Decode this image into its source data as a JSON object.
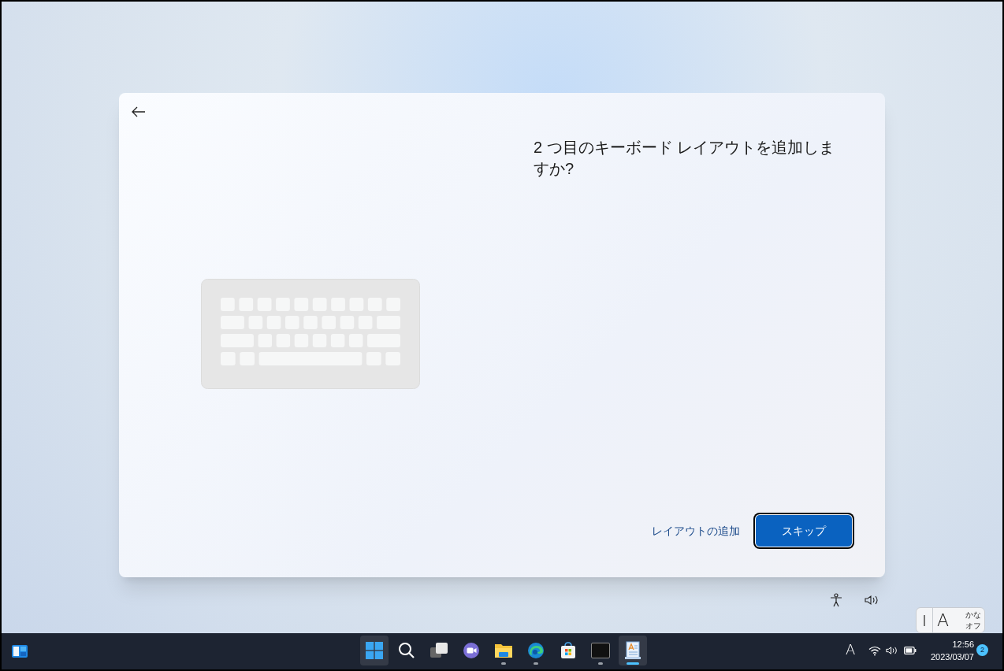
{
  "dialog": {
    "title": "2 つ目のキーボード レイアウトを追加しますか?",
    "secondary_button": "レイアウトの追加",
    "primary_button": "スキップ"
  },
  "ime_toolbar": {
    "mode": "A",
    "kana": "かな",
    "state": "オフ"
  },
  "taskbar": {
    "apps": [
      {
        "kind": "start",
        "running": false,
        "active": true
      },
      {
        "kind": "search",
        "running": false,
        "active": false
      },
      {
        "kind": "taskview",
        "running": false,
        "active": false
      },
      {
        "kind": "chat",
        "running": false,
        "active": false
      },
      {
        "kind": "explorer",
        "running": true,
        "active": false
      },
      {
        "kind": "edge",
        "running": true,
        "active": false
      },
      {
        "kind": "store",
        "running": false,
        "active": false
      },
      {
        "kind": "terminal",
        "running": true,
        "active": false
      },
      {
        "kind": "wordpad",
        "running": true,
        "active": true
      }
    ],
    "input_indicator": "A",
    "time": "12:56",
    "date": "2023/03/07",
    "notifications": "2"
  }
}
